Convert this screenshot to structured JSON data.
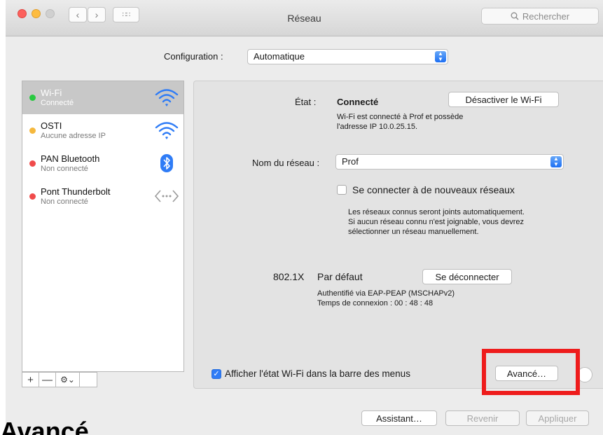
{
  "window": {
    "title": "Réseau"
  },
  "toolbar": {
    "search_placeholder": "Rechercher"
  },
  "config": {
    "label": "Configuration :",
    "value": "Automatique"
  },
  "services": [
    {
      "name": "Wi-Fi",
      "status": "Connecté",
      "status_color": "#28c940",
      "icon": "wifi-icon",
      "selected": true
    },
    {
      "name": "OSTI",
      "status": "Aucune adresse IP",
      "status_color": "#f5b83d",
      "icon": "wifi-icon",
      "selected": false
    },
    {
      "name": "PAN Bluetooth",
      "status": "Non connecté",
      "status_color": "#f04a4a",
      "icon": "bluetooth-icon",
      "selected": false
    },
    {
      "name": "Pont Thunderbolt",
      "status": "Non connecté",
      "status_color": "#f04a4a",
      "icon": "thunderbolt-bridge-icon",
      "selected": false
    }
  ],
  "sidebar_tools": {
    "add": "+",
    "remove": "—",
    "gear": "⚙⌄"
  },
  "detail": {
    "state_label": "État :",
    "state_value": "Connecté",
    "toggle_wifi": "Désactiver le Wi-Fi",
    "state_desc_1": "Wi-Fi est connecté à Prof et possède",
    "state_desc_2": "l'adresse IP 10.0.25.15.",
    "network_label": "Nom du réseau :",
    "network_value": "Prof",
    "join_new_label": "Se connecter à de nouveaux réseaux",
    "join_desc_1": "Les réseaux connus seront joints automatiquement.",
    "join_desc_2": "Si aucun réseau connu n'est joignable, vous devrez",
    "join_desc_3": "sélectionner un réseau manuellement.",
    "dot1x_label": "802.1X",
    "dot1x_value": "Par défaut",
    "disconnect": "Se déconnecter",
    "auth_desc": "Authentifié via EAP-PEAP (MSCHAPv2)",
    "conn_time": "Temps de connexion : 00 : 48 : 48",
    "show_status_label": "Afficher l'état Wi-Fi dans la barre des menus",
    "advanced": "Avancé…"
  },
  "footer": {
    "assistant": "Assistant…",
    "revert": "Revenir",
    "apply": "Appliquer"
  },
  "caption": "Avancé",
  "colors": {
    "highlight": "#ee1c1c",
    "accent": "#2f7cf6"
  }
}
